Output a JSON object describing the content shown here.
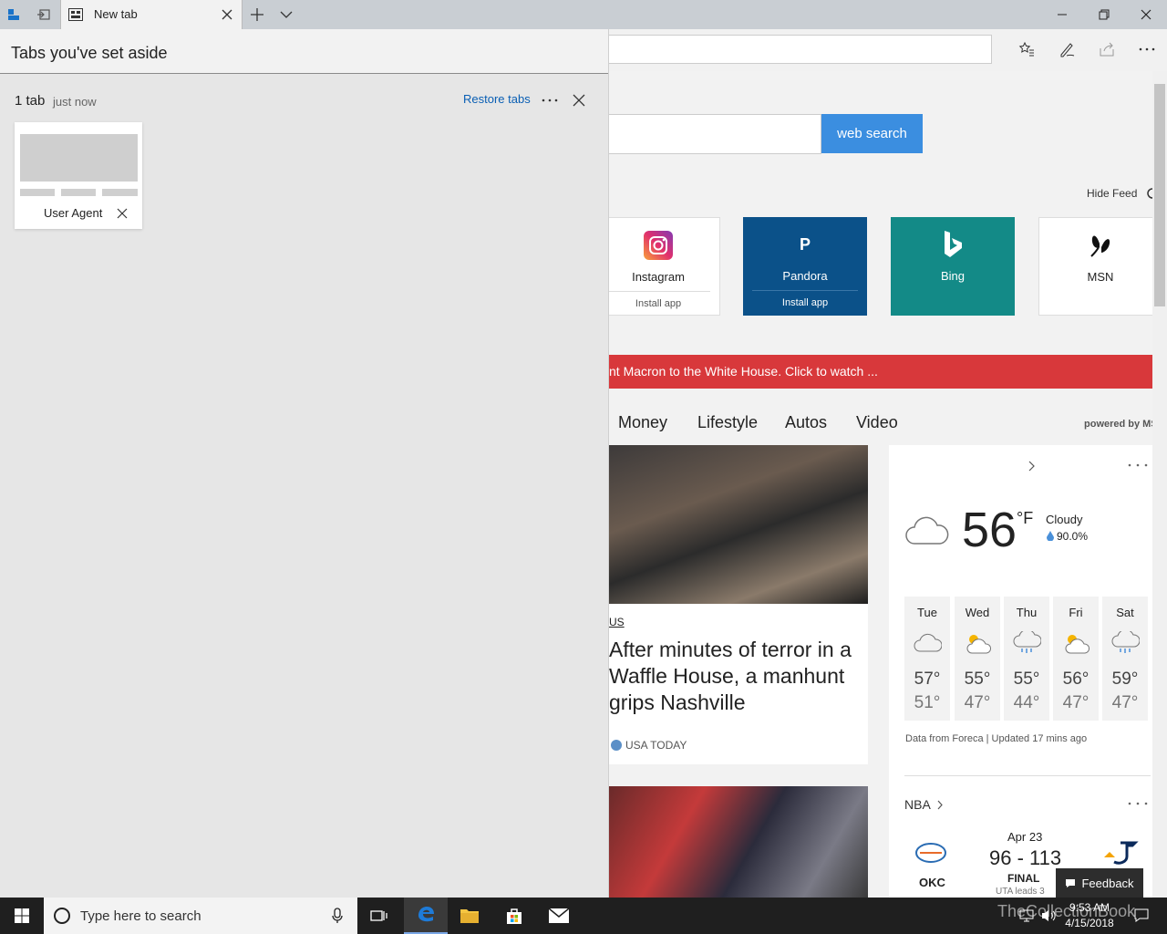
{
  "tabbar": {
    "active_tab_title": "New tab"
  },
  "page": {
    "search_button": "web search",
    "hide_feed": "Hide Feed",
    "tiles": [
      {
        "name": "Instagram",
        "install": "Install app",
        "bg": "#ffffff",
        "fg": "#222222"
      },
      {
        "name": "Pandora",
        "install": "Install app",
        "bg": "#0b5189",
        "fg": "#ffffff"
      },
      {
        "name": "Bing",
        "install": "",
        "bg": "#138a87",
        "fg": "#ffffff"
      },
      {
        "name": "MSN",
        "install": "",
        "bg": "#ffffff",
        "fg": "#222222"
      }
    ],
    "pandora_letter": "P",
    "breaking": "nt Macron to the White House. Click to watch ...",
    "categories": [
      "Money",
      "Lifestyle",
      "Autos",
      "Video"
    ],
    "powered_by": "powered by MS",
    "news": {
      "category": "US",
      "title": "After minutes of terror in a Waffle House, a manhunt grips Nashville",
      "source": "USA TODAY"
    },
    "weather": {
      "temp": "56",
      "unit": "°F",
      "condition": "Cloudy",
      "precip": "90.0%",
      "days": [
        {
          "day": "Tue",
          "icon": "cloudy-icon",
          "hi": "57°",
          "lo": "51°"
        },
        {
          "day": "Wed",
          "icon": "partly-sunny-icon",
          "hi": "55°",
          "lo": "47°"
        },
        {
          "day": "Thu",
          "icon": "rain-icon",
          "hi": "55°",
          "lo": "44°"
        },
        {
          "day": "Fri",
          "icon": "partly-sunny-icon",
          "hi": "56°",
          "lo": "47°"
        },
        {
          "day": "Sat",
          "icon": "rain-icon",
          "hi": "59°",
          "lo": "47°"
        }
      ],
      "source": "Data from Foreca | Updated 17 mins ago"
    },
    "nba": {
      "label": "NBA",
      "date": "Apr 23",
      "score": "96 - 113",
      "status": "FINAL",
      "note": "UTA leads 3",
      "team": "OKC"
    }
  },
  "aside": {
    "title": "Tabs you've set aside",
    "count": "1 tab",
    "time": "just now",
    "restore": "Restore tabs",
    "saved_tab_title": "User Agent"
  },
  "feedback": "Feedback",
  "taskbar": {
    "search_placeholder": "Type here to search",
    "time": "9:53 AM",
    "date": "4/15/2018",
    "watermark": "TheCollectionBook"
  }
}
